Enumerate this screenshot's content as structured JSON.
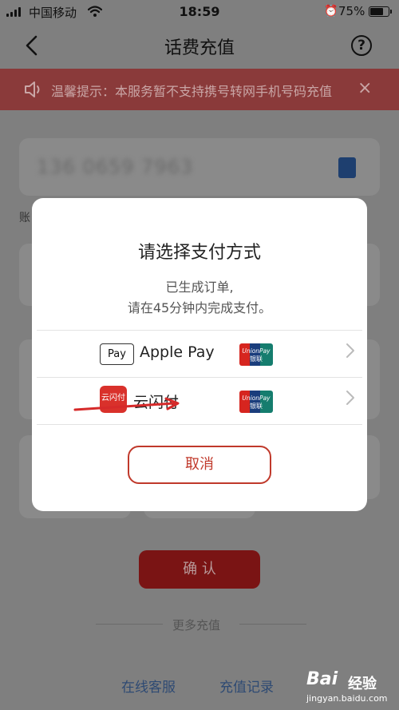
{
  "status_bar": {
    "carrier": "中国移动",
    "time": "18:59",
    "battery_percent": "75%",
    "battery_level": 0.75
  },
  "nav": {
    "title": "话费充值",
    "help_glyph": "?"
  },
  "notice": {
    "text": "温馨提示：本服务暂不支持携号转网手机号码充值",
    "close_glyph": "×"
  },
  "account_label": "账",
  "phone_masked": "136 0659 7963",
  "confirm_label": "确 认",
  "more_label": "更多充值",
  "links": {
    "service": "在线客服",
    "history": "充值记录"
  },
  "modal": {
    "title": "请选择支付方式",
    "subtitle_line1": "已生成订单,",
    "subtitle_line2": "请在45分钟内完成支付。",
    "options": [
      {
        "badge": "Pay",
        "label": "Apple Pay",
        "network": "UnionPay 银联"
      },
      {
        "badge": "云闪付",
        "label": "云闪付",
        "network": "UnionPay 银联"
      }
    ],
    "cancel_label": "取消"
  },
  "watermark": {
    "logo": "Bai",
    "sub": "经验",
    "url": "jingyan.baidu.com"
  },
  "colors": {
    "accent_red": "#c0392b",
    "overlay_gray": "#7f7f7f",
    "link_blue": "#2e4a73"
  }
}
